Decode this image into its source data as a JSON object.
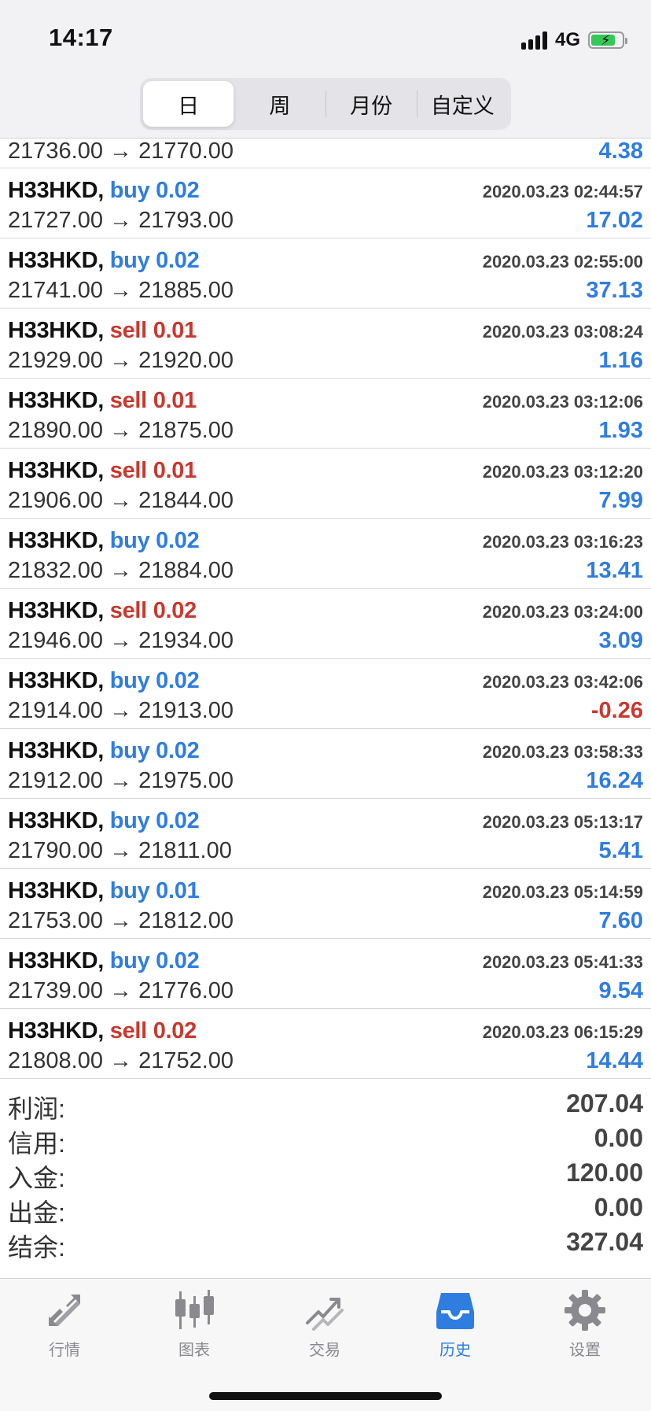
{
  "status_bar": {
    "time": "14:17",
    "network": "4G"
  },
  "segments": [
    {
      "label": "日",
      "active": true
    },
    {
      "label": "周",
      "active": false
    },
    {
      "label": "月份",
      "active": false
    },
    {
      "label": "自定义",
      "active": false
    }
  ],
  "partial_row": {
    "prices": "21736.00 → 21770.00",
    "profit": "4.38"
  },
  "trades": [
    {
      "symbol": "H33HKD,",
      "side": "buy 0.02",
      "type": "buy",
      "datetime": "2020.03.23 02:44:57",
      "prices": "21727.00 → 21793.00",
      "profit": "17.02"
    },
    {
      "symbol": "H33HKD,",
      "side": "buy 0.02",
      "type": "buy",
      "datetime": "2020.03.23 02:55:00",
      "prices": "21741.00 → 21885.00",
      "profit": "37.13"
    },
    {
      "symbol": "H33HKD,",
      "side": "sell 0.01",
      "type": "sell",
      "datetime": "2020.03.23 03:08:24",
      "prices": "21929.00 → 21920.00",
      "profit": "1.16"
    },
    {
      "symbol": "H33HKD,",
      "side": "sell 0.01",
      "type": "sell",
      "datetime": "2020.03.23 03:12:06",
      "prices": "21890.00 → 21875.00",
      "profit": "1.93"
    },
    {
      "symbol": "H33HKD,",
      "side": "sell 0.01",
      "type": "sell",
      "datetime": "2020.03.23 03:12:20",
      "prices": "21906.00 → 21844.00",
      "profit": "7.99"
    },
    {
      "symbol": "H33HKD,",
      "side": "buy 0.02",
      "type": "buy",
      "datetime": "2020.03.23 03:16:23",
      "prices": "21832.00 → 21884.00",
      "profit": "13.41"
    },
    {
      "symbol": "H33HKD,",
      "side": "sell 0.02",
      "type": "sell",
      "datetime": "2020.03.23 03:24:00",
      "prices": "21946.00 → 21934.00",
      "profit": "3.09"
    },
    {
      "symbol": "H33HKD,",
      "side": "buy 0.02",
      "type": "buy",
      "datetime": "2020.03.23 03:42:06",
      "prices": "21914.00 → 21913.00",
      "profit": "-0.26"
    },
    {
      "symbol": "H33HKD,",
      "side": "buy 0.02",
      "type": "buy",
      "datetime": "2020.03.23 03:58:33",
      "prices": "21912.00 → 21975.00",
      "profit": "16.24"
    },
    {
      "symbol": "H33HKD,",
      "side": "buy 0.02",
      "type": "buy",
      "datetime": "2020.03.23 05:13:17",
      "prices": "21790.00 → 21811.00",
      "profit": "5.41"
    },
    {
      "symbol": "H33HKD,",
      "side": "buy 0.01",
      "type": "buy",
      "datetime": "2020.03.23 05:14:59",
      "prices": "21753.00 → 21812.00",
      "profit": "7.60"
    },
    {
      "symbol": "H33HKD,",
      "side": "buy 0.02",
      "type": "buy",
      "datetime": "2020.03.23 05:41:33",
      "prices": "21739.00 → 21776.00",
      "profit": "9.54"
    },
    {
      "symbol": "H33HKD,",
      "side": "sell 0.02",
      "type": "sell",
      "datetime": "2020.03.23 06:15:29",
      "prices": "21808.00 → 21752.00",
      "profit": "14.44"
    }
  ],
  "summary": [
    {
      "label": "利润:",
      "value": "207.04"
    },
    {
      "label": "信用:",
      "value": "0.00"
    },
    {
      "label": "入金:",
      "value": "120.00"
    },
    {
      "label": "出金:",
      "value": "0.00"
    },
    {
      "label": "结余:",
      "value": "327.04"
    }
  ],
  "tabs": [
    {
      "label": "行情",
      "icon": "quotes-icon",
      "active": false
    },
    {
      "label": "图表",
      "icon": "chart-icon",
      "active": false
    },
    {
      "label": "交易",
      "icon": "trade-icon",
      "active": false
    },
    {
      "label": "历史",
      "icon": "history-icon",
      "active": true
    },
    {
      "label": "设置",
      "icon": "settings-icon",
      "active": false
    }
  ],
  "colors": {
    "buy": "#2f7de1",
    "sell": "#c9382e",
    "active_tab": "#2f7de1",
    "inactive_tab": "#8a8a8e"
  }
}
